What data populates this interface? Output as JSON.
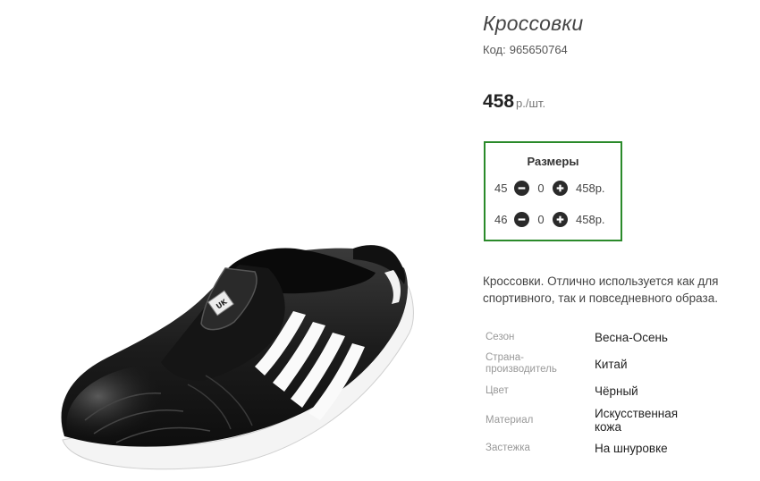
{
  "product": {
    "title": "Кроссовки",
    "code_label": "Код:",
    "code_value": "965650764",
    "price_value": "458",
    "price_unit": "р./шт."
  },
  "sizes": {
    "title": "Размеры",
    "rows": [
      {
        "size": "45",
        "quantity": "0",
        "price": "458р."
      },
      {
        "size": "46",
        "quantity": "0",
        "price": "458р."
      }
    ]
  },
  "description": "Кроссовки. Отлично используется как для спортивного, так и повседневного образа.",
  "attributes": [
    {
      "label": "Сезон",
      "value": "Весна-Осень"
    },
    {
      "label": "Страна-производитель",
      "value": "Китай"
    },
    {
      "label": "Цвет",
      "value": "Чёрный"
    },
    {
      "label": "Материал",
      "value": "Искусственная кожа"
    },
    {
      "label": "Застежка",
      "value": "На шнуровке"
    }
  ],
  "colors": {
    "sizes_border": "#2a8a2a",
    "button_bg": "#2a2a2a",
    "shoe": "#1a1a1a",
    "stripes": "#ffffff"
  },
  "icons": [
    "minus-circle-icon",
    "plus-circle-icon"
  ],
  "image": {
    "logo_text": "UK"
  }
}
